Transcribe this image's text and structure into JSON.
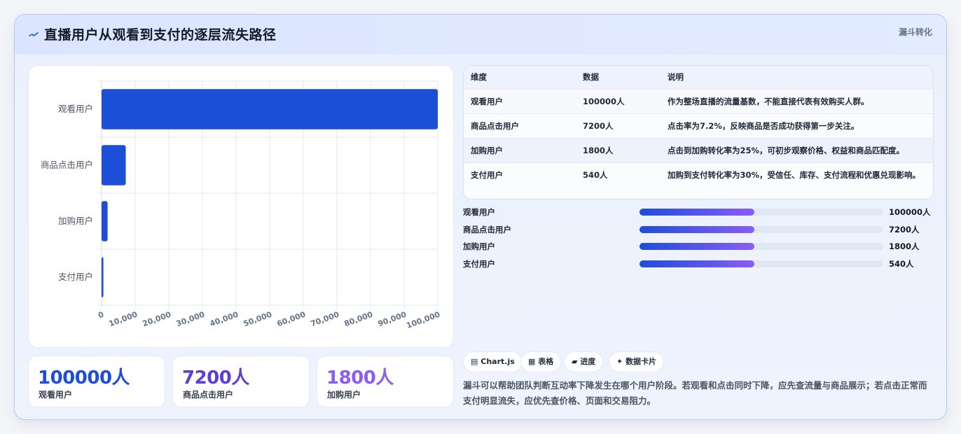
{
  "header": {
    "title": "直播用户从观看到支付的逐层流失路径",
    "tag": "漏斗转化",
    "icon": "pulse-icon"
  },
  "chart_data": {
    "type": "bar",
    "orientation": "horizontal",
    "categories": [
      "观看用户",
      "商品点击用户",
      "加购用户",
      "支付用户"
    ],
    "values": [
      100000,
      7200,
      1800,
      540
    ],
    "xlim": [
      0,
      100000
    ],
    "xticks": [
      "0",
      "10,000",
      "20,000",
      "30,000",
      "40,000",
      "50,000",
      "60,000",
      "70,000",
      "80,000",
      "90,000",
      "100,000"
    ],
    "grid": true,
    "bar_color": "#1d4ed8"
  },
  "kpis": [
    {
      "value": "100000人",
      "label": "观看用户",
      "color": "#1d4ed8"
    },
    {
      "value": "7200人",
      "label": "商品点击用户",
      "color": "#5b3fd6"
    },
    {
      "value": "1800人",
      "label": "加购用户",
      "color": "#8b5cf6"
    }
  ],
  "table": {
    "headers": [
      "维度",
      "数据",
      "说明"
    ],
    "rows": [
      {
        "dim": "观看用户",
        "data": "100000人",
        "desc": "作为整场直播的流量基数，不能直接代表有效购买人群。"
      },
      {
        "dim": "商品点击用户",
        "data": "7200人",
        "desc": "点击率为7.2%，反映商品是否成功获得第一步关注。"
      },
      {
        "dim": "加购用户",
        "data": "1800人",
        "desc": "点击到加购转化率为25%，可初步观察价格、权益和商品匹配度。"
      },
      {
        "dim": "支付用户",
        "data": "540人",
        "desc": "加购到支付转化率为30%，受信任、库存、支付流程和优惠兑现影响。"
      }
    ]
  },
  "progress": [
    {
      "label": "观看用户",
      "value": "100000人",
      "fill": 0.47
    },
    {
      "label": "商品点击用户",
      "value": "7200人",
      "fill": 0.47
    },
    {
      "label": "加购用户",
      "value": "1800人",
      "fill": 0.47
    },
    {
      "label": "支付用户",
      "value": "540人",
      "fill": 0.47
    }
  ],
  "chips": [
    {
      "icon": "chart-icon",
      "glyph": "▤",
      "label": "Chart.js"
    },
    {
      "icon": "table-icon",
      "glyph": "▦",
      "label": "表格"
    },
    {
      "icon": "progress-icon",
      "glyph": "▰",
      "label": "进度"
    },
    {
      "icon": "card-icon",
      "glyph": "✦",
      "label": "数据卡片"
    }
  ],
  "note": "漏斗可以帮助团队判断互动率下降发生在哪个用户阶段。若观看和点击同时下降，应先查流量与商品展示；若点击正常而支付明显流失，应优先查价格、页面和交易阻力。"
}
